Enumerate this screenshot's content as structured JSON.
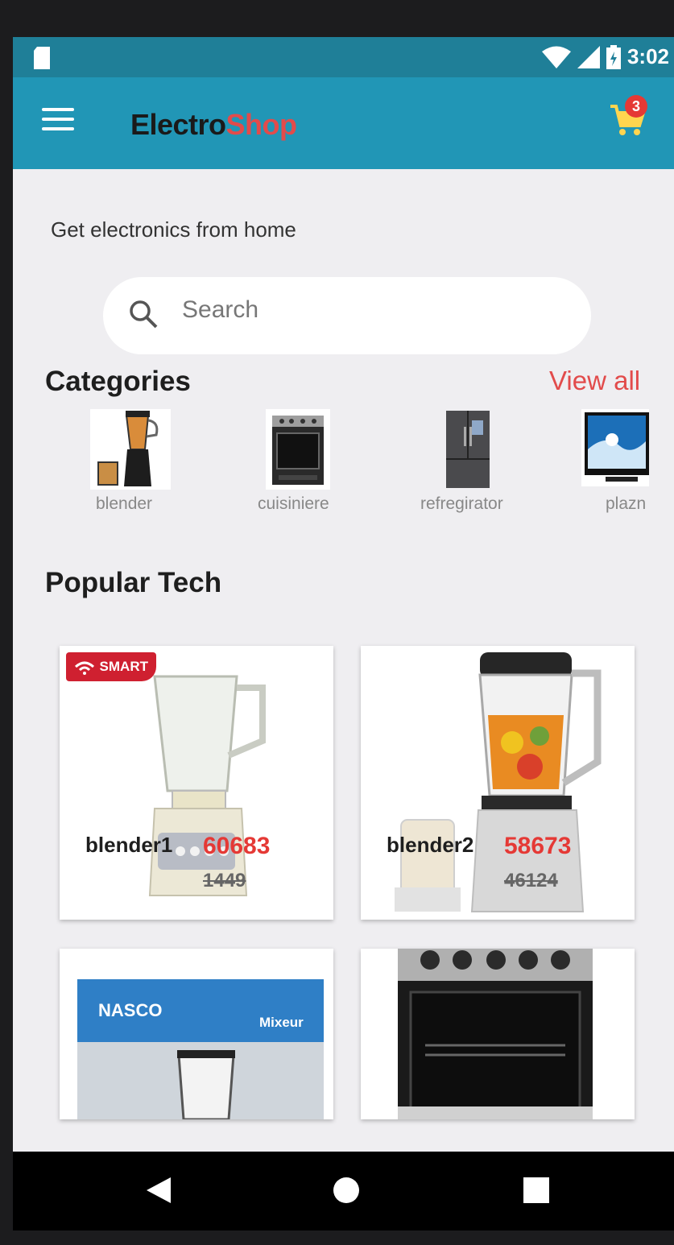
{
  "status_bar": {
    "time": "3:02"
  },
  "app_bar": {
    "logo_part1": "Electro",
    "logo_part2": "Shop",
    "cart_count": "3"
  },
  "home": {
    "tagline": "Get electronics from home",
    "search_placeholder": "Search",
    "categories_title": "Categories",
    "view_all": "View all",
    "popular_title": "Popular Tech"
  },
  "categories": [
    {
      "label": "blender"
    },
    {
      "label": "cuisiniere"
    },
    {
      "label": "refregirator"
    },
    {
      "label": "plazn"
    }
  ],
  "products": [
    {
      "name": "blender1",
      "price": "60683",
      "old_price": "1449",
      "badge": "SMART"
    },
    {
      "name": "blender2",
      "price": "58673",
      "old_price": "46124"
    },
    {
      "box_brand": "NASCO",
      "box_label": "Mixeur"
    },
    {}
  ],
  "colors": {
    "status_bar": "#1f7f98",
    "app_bar": "#2196b6",
    "accent_red": "#e24b4b",
    "background": "#efeef1"
  }
}
